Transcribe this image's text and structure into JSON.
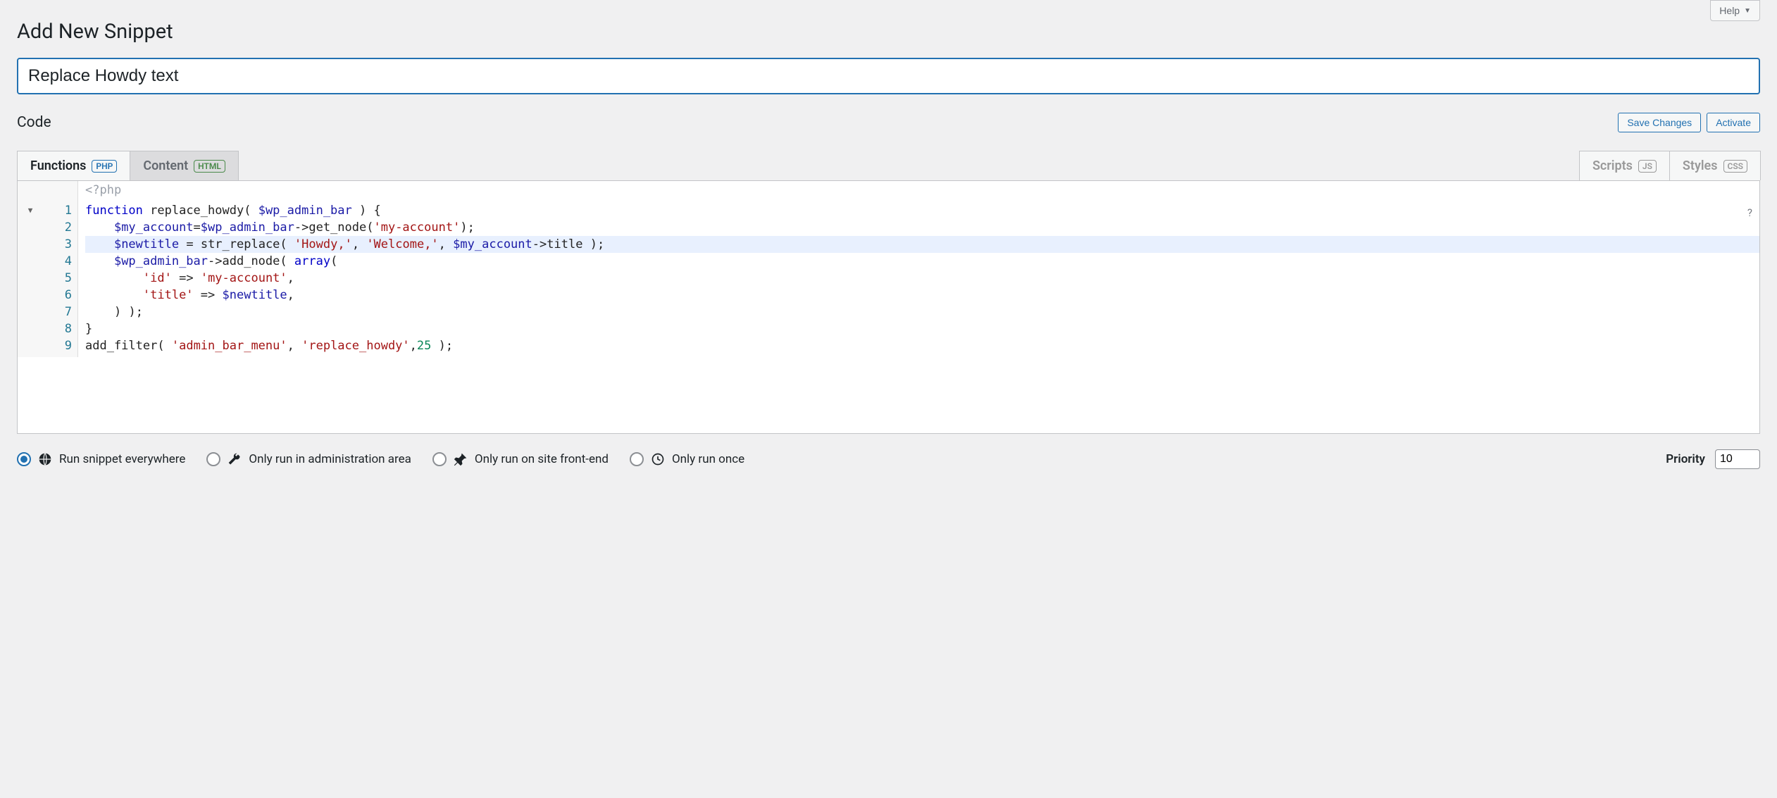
{
  "header": {
    "title": "Add New Snippet",
    "help_label": "Help"
  },
  "snippet": {
    "title_value": "Replace Howdy text"
  },
  "code_section": {
    "label": "Code",
    "save_label": "Save Changes",
    "activate_label": "Activate",
    "php_open": "<?php",
    "help_char": "?"
  },
  "tabs": {
    "functions": {
      "label": "Functions",
      "badge": "PHP"
    },
    "content": {
      "label": "Content",
      "badge": "HTML"
    },
    "scripts": {
      "label": "Scripts",
      "badge": "JS"
    },
    "styles": {
      "label": "Styles",
      "badge": "CSS"
    }
  },
  "code": {
    "line_numbers": [
      "1",
      "2",
      "3",
      "4",
      "5",
      "6",
      "7",
      "8",
      "9"
    ],
    "lines_plain": [
      "function replace_howdy( $wp_admin_bar ) {",
      "    $my_account=$wp_admin_bar->get_node('my-account');",
      "    $newtitle = str_replace( 'Howdy,', 'Welcome,', $my_account->title );",
      "    $wp_admin_bar->add_node( array(",
      "        'id' => 'my-account',",
      "        'title' => $newtitle,",
      "    ) );",
      "}",
      "add_filter( 'admin_bar_menu', 'replace_howdy',25 );"
    ],
    "highlighted_line": 3,
    "fold_marker": "▼"
  },
  "scope": {
    "options": [
      {
        "key": "everywhere",
        "label": "Run snippet everywhere",
        "icon": "globe"
      },
      {
        "key": "admin",
        "label": "Only run in administration area",
        "icon": "wrench"
      },
      {
        "key": "frontend",
        "label": "Only run on site front-end",
        "icon": "pin"
      },
      {
        "key": "once",
        "label": "Only run once",
        "icon": "clock"
      }
    ],
    "selected": "everywhere"
  },
  "priority": {
    "label": "Priority",
    "value": "10"
  }
}
